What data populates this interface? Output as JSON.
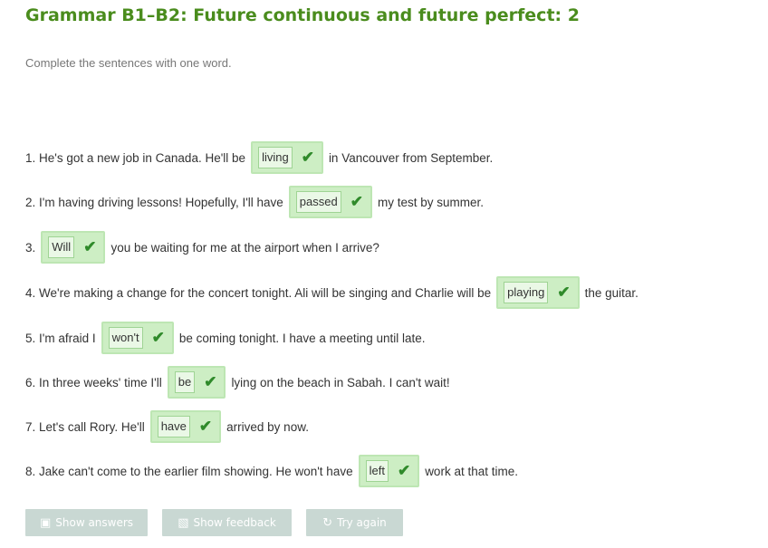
{
  "exercise": {
    "title": "Grammar B1–B2: Future continuous and future perfect: 2",
    "instructions": "Complete the sentences with one word.",
    "sentences": [
      {
        "before": "1. He's got a new job in Canada. He'll be",
        "answer": "living",
        "after": "in Vancouver from September."
      },
      {
        "before": "2. I'm having driving lessons! Hopefully, I'll have",
        "answer": "passed",
        "after": "my test by summer."
      },
      {
        "before": "3.",
        "answer": "Will",
        "after": "you be waiting for me at the airport when I arrive?"
      },
      {
        "before": "4. We're making a change for the concert tonight. Ali will be singing and Charlie will be",
        "answer": "playing",
        "after": "the guitar."
      },
      {
        "before": "5. I'm afraid I",
        "answer": "won't",
        "after": "be coming tonight. I have a meeting until late."
      },
      {
        "before": "6. In three weeks' time I'll",
        "answer": "be",
        "after": "lying on the beach in Sabah. I can't wait!"
      },
      {
        "before": "7. Let's call Rory. He'll",
        "answer": "have",
        "after": "arrived by now."
      },
      {
        "before": "8. Jake can't come to the earlier film showing. He won't have",
        "answer": "left",
        "after": "work at that time."
      }
    ],
    "check_icon": "checkmark-icon"
  },
  "buttons": {
    "show_answers": {
      "label": "Show answers",
      "icon": "book-icon"
    },
    "show_feedback": {
      "label": "Show feedback",
      "icon": "feedback-icon"
    },
    "try_again": {
      "label": "Try again",
      "icon": "refresh-icon"
    }
  },
  "colors": {
    "title": "#4a8c1d",
    "answer_bg": "#cdeec4",
    "check": "#2f8a2a",
    "button_bg": "#c9d8d3"
  }
}
